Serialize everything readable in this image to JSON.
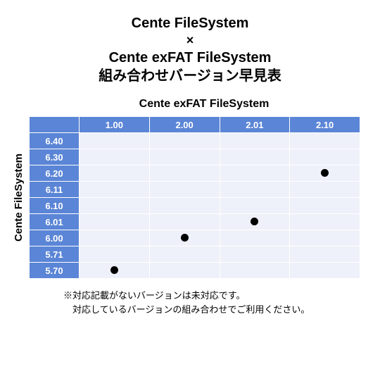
{
  "title": {
    "line1": "Cente FileSystem",
    "x": "×",
    "line2": "Cente exFAT FileSystem",
    "line3": "組み合わせバージョン早見表"
  },
  "col_axis_label": "Cente exFAT FileSystem",
  "row_axis_label": "Cente FileSystem",
  "footnote": {
    "line1": "※対応記載がないバージョンは未対応です。",
    "line2": "　対応しているバージョンの組み合わせでご利用ください。"
  },
  "chart_data": {
    "type": "heatmap",
    "title": "Cente FileSystem × Cente exFAT FileSystem 組み合わせバージョン早見表",
    "xlabel": "Cente exFAT FileSystem",
    "ylabel": "Cente FileSystem",
    "x_categories": [
      "1.00",
      "2.00",
      "2.01",
      "2.10"
    ],
    "y_categories": [
      "6.40",
      "6.30",
      "6.20",
      "6.11",
      "6.10",
      "6.01",
      "6.00",
      "5.71",
      "5.70"
    ],
    "cells": [
      {
        "row": "6.20",
        "col": "2.10",
        "mark": true
      },
      {
        "row": "6.01",
        "col": "2.01",
        "mark": true
      },
      {
        "row": "6.00",
        "col": "2.00",
        "mark": true
      },
      {
        "row": "5.70",
        "col": "1.00",
        "mark": true
      }
    ]
  }
}
